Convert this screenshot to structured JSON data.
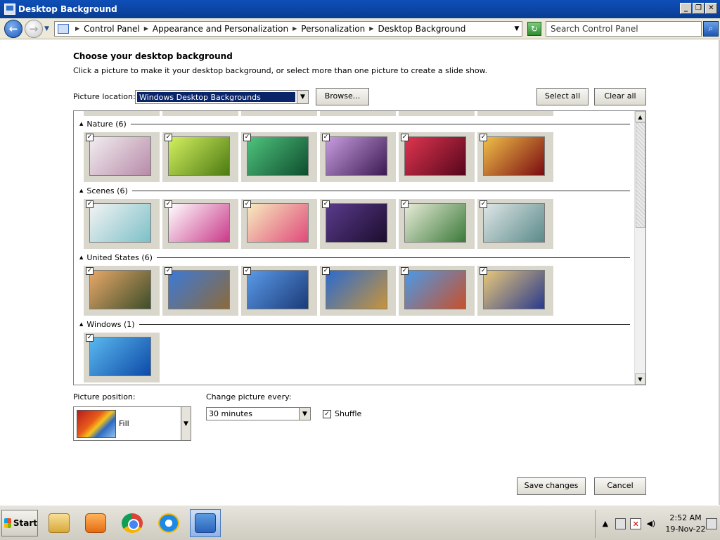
{
  "window": {
    "title": "Desktop Background",
    "icon": "control-panel-icon",
    "min_glyph": "_",
    "restore_glyph": "❐",
    "close_glyph": "✕"
  },
  "address": {
    "crumbs": [
      "Control Panel",
      "Appearance and Personalization",
      "Personalization",
      "Desktop Background"
    ],
    "search_placeholder": "Search Control Panel"
  },
  "main": {
    "heading": "Choose your desktop background",
    "description": "Click a picture to make it your desktop background, or select more than one picture to create a slide show.",
    "picture_location_label": "Picture location:",
    "picture_location_value": "Windows Desktop Backgrounds",
    "browse_label": "Browse...",
    "select_all_label": "Select all",
    "clear_all_label": "Clear all"
  },
  "gallery": {
    "groups": [
      {
        "label": "Nature (6)",
        "count": 6,
        "images": [
          {
            "colors": [
              "#f1eef0",
              "#b88aa8"
            ],
            "checked": true
          },
          {
            "colors": [
              "#d4f060",
              "#4c7a12"
            ],
            "checked": true
          },
          {
            "colors": [
              "#4fc47d",
              "#0e4d2e"
            ],
            "checked": true
          },
          {
            "colors": [
              "#c79ce0",
              "#3b1a50"
            ],
            "checked": true
          },
          {
            "colors": [
              "#e0354f",
              "#55061c"
            ],
            "checked": true
          },
          {
            "colors": [
              "#f0c048",
              "#7a0a10"
            ],
            "checked": true
          }
        ]
      },
      {
        "label": "Scenes (6)",
        "count": 6,
        "images": [
          {
            "colors": [
              "#f3f3f3",
              "#7cc0c8"
            ],
            "checked": true
          },
          {
            "colors": [
              "#ffffff",
              "#c93a8a"
            ],
            "checked": true
          },
          {
            "colors": [
              "#f7ecbf",
              "#e04a7a"
            ],
            "checked": true
          },
          {
            "colors": [
              "#5a3b8c",
              "#1c0d2e"
            ],
            "checked": true
          },
          {
            "colors": [
              "#e8ecd8",
              "#3c7a3a"
            ],
            "checked": true
          },
          {
            "colors": [
              "#dfe6e6",
              "#5b8a8a"
            ],
            "checked": true
          }
        ]
      },
      {
        "label": "United States (6)",
        "count": 6,
        "images": [
          {
            "colors": [
              "#e8a868",
              "#3c4d2a"
            ],
            "checked": true
          },
          {
            "colors": [
              "#3c7ad8",
              "#8c6a3a"
            ],
            "checked": true
          },
          {
            "colors": [
              "#5a9ae8",
              "#1c3a78"
            ],
            "checked": true
          },
          {
            "colors": [
              "#2a6ad0",
              "#c8943a"
            ],
            "checked": true
          },
          {
            "colors": [
              "#4a9ae8",
              "#c8502a"
            ],
            "checked": true
          },
          {
            "colors": [
              "#e8c87a",
              "#2a3a8c"
            ],
            "checked": true
          }
        ]
      },
      {
        "label": "Windows (1)",
        "count": 1,
        "images": [
          {
            "colors": [
              "#5ab8ee",
              "#0c4aa8"
            ],
            "checked": true
          }
        ]
      }
    ]
  },
  "picture_position": {
    "label": "Picture position:",
    "value": "Fill"
  },
  "change_picture": {
    "label": "Change picture every:",
    "value": "30 minutes"
  },
  "shuffle": {
    "label": "Shuffle",
    "checked": true
  },
  "buttons": {
    "save_label": "Save changes",
    "cancel_label": "Cancel"
  },
  "taskbar": {
    "start_label": "Start",
    "apps": [
      "explorer-icon",
      "media-player-icon",
      "chrome-icon",
      "internet-explorer-icon",
      "control-panel-icon"
    ],
    "time": "2:52 AM",
    "date": "19-Nov-22"
  }
}
